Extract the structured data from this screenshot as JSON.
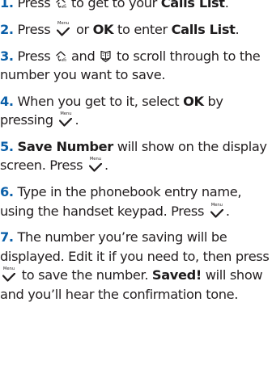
{
  "steps": [
    {
      "num": "1.",
      "t1": " Press ",
      "t2": " to get to your ",
      "b1": "Calls List",
      "t3": "."
    },
    {
      "num": "2.",
      "t1": " Press ",
      "t2": " or ",
      "b1": "OK",
      "t3": " to enter ",
      "b2": "Calls List",
      "t4": "."
    },
    {
      "num": "3.",
      "t1": " Press ",
      "t2": " and ",
      "t3": " to scroll through to the number you want to save."
    },
    {
      "num": "4.",
      "t1": " When you get to it, select ",
      "b1": "OK",
      "t2": " by pressing ",
      "t3": "."
    },
    {
      "num": "5.",
      "b1": "Save Number",
      "t1": " will show on the display screen. Press ",
      "t2": "."
    },
    {
      "num": "6.",
      "t1": " Type in the phonebook entry name, using the handset keypad. Press ",
      "t2": "."
    },
    {
      "num": "7.",
      "t1": " The number you’re saving will be displayed. Edit it if you need to, then press ",
      "t2": " to save the number. ",
      "b1": "Saved!",
      "t3": " will show and you’ll hear the confirmation tone."
    }
  ],
  "menu_key_label": "Menu",
  "colors": {
    "step_number": "#0a5fa8",
    "text": "#231f20"
  },
  "icons": {
    "up_key": "calls-up-key-icon",
    "down_key": "phonebook-down-key-icon",
    "menu_key": "menu-checkmark-key-icon"
  }
}
